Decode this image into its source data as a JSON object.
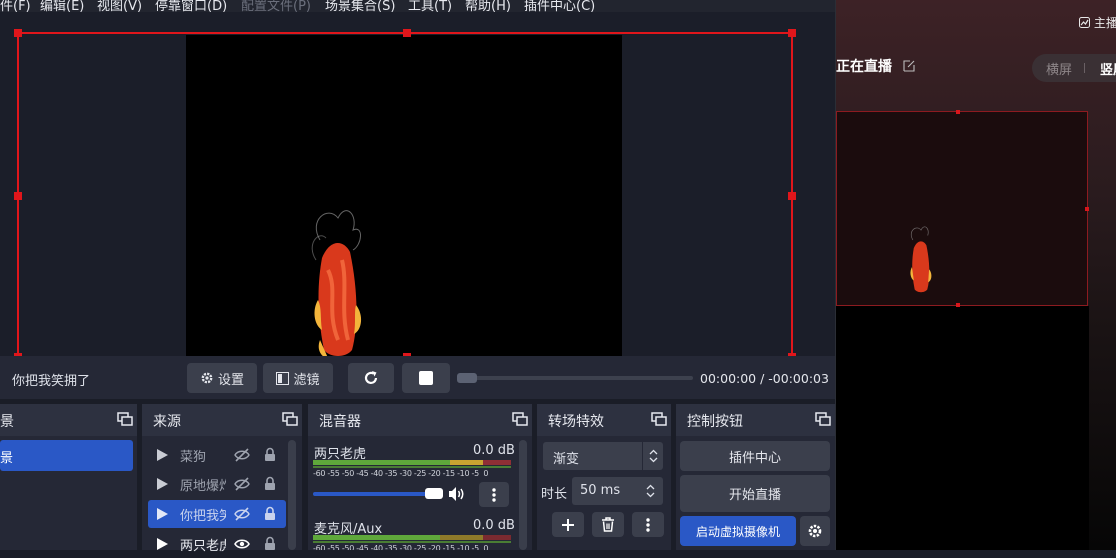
{
  "menu": [
    {
      "label": "件(F)",
      "disabled": false
    },
    {
      "label": "编辑(E)",
      "disabled": false
    },
    {
      "label": "视图(V)",
      "disabled": false
    },
    {
      "label": "停靠窗口(D)",
      "disabled": false
    },
    {
      "label": "配置文件(P)",
      "disabled": true
    },
    {
      "label": "场景集合(S)",
      "disabled": false
    },
    {
      "label": "工具(T)",
      "disabled": false
    },
    {
      "label": "帮助(H)",
      "disabled": false
    },
    {
      "label": "插件中心(C)",
      "disabled": false
    }
  ],
  "right_panel": {
    "top_label": "主播",
    "live_title": "正在直播",
    "orientation_options": [
      "横屏",
      "竖屏"
    ],
    "orientation_selected": "竖屏"
  },
  "control_bar": {
    "source_name": "你把我笑拥了",
    "settings_label": "设置",
    "filters_label": "滤镜",
    "time_display": "00:00:00  /  -00:00:03",
    "seek_progress": 0
  },
  "scenes_dock": {
    "title": "景",
    "items": [
      {
        "label": "景",
        "selected": true
      }
    ]
  },
  "sources_dock": {
    "title": "来源",
    "items": [
      {
        "label": "菜狗",
        "visible": false,
        "locked": true,
        "selected": false
      },
      {
        "label": "原地爆炸",
        "visible": false,
        "locked": true,
        "selected": false
      },
      {
        "label": "你把我笑拥了",
        "visible": false,
        "locked": true,
        "selected": true
      },
      {
        "label": "两只老虎",
        "visible": true,
        "locked": true,
        "selected": false
      }
    ]
  },
  "mixer_dock": {
    "title": "混音器",
    "channels": [
      {
        "name": "两只老虎",
        "db": "0.0 dB",
        "scale": "-60 -55 -50 -45 -40 -35 -30 -25 -20 -15 -10 -5  0",
        "volume": 1.0
      },
      {
        "name": "麦克风/Aux",
        "db": "0.0 dB",
        "scale": "-60 -55 -50 -45 -40 -35 -30 -25 -20 -15 -10 -5  0",
        "volume": 1.0
      }
    ]
  },
  "transitions_dock": {
    "title": "转场特效",
    "transition": "渐变",
    "duration_label": "时长",
    "duration_value": "50 ms"
  },
  "controls_dock": {
    "title": "控制按钮",
    "plugin_center": "插件中心",
    "start_stream": "开始直播",
    "virtual_camera": "启动虚拟摄像机"
  },
  "colors": {
    "accent": "#2a58c6",
    "selection_red": "#e0161b",
    "meter_green": "#5fa83b",
    "meter_yellow": "#c8a431",
    "meter_red": "#c4363a"
  }
}
